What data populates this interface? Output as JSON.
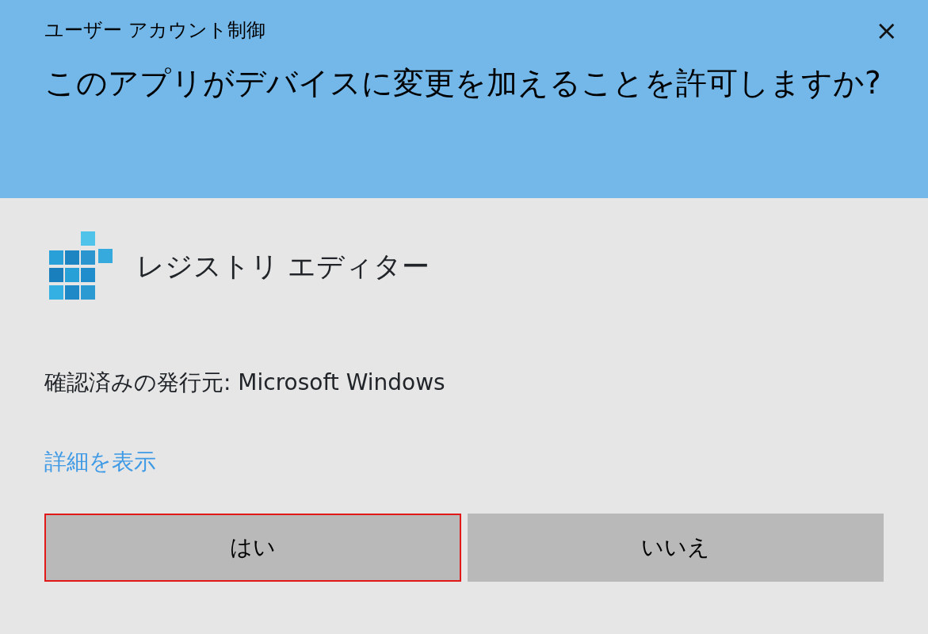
{
  "window": {
    "title": "ユーザー アカウント制御",
    "close": "×"
  },
  "question": "このアプリがデバイスに変更を加えることを許可しますか?",
  "app": {
    "name": "レジストリ エディター"
  },
  "publisher": "確認済みの発行元: Microsoft Windows",
  "details_link": "詳細を表示",
  "buttons": [
    {
      "label": "はい",
      "highlighted": true
    },
    {
      "label": "いいえ",
      "highlighted": false
    }
  ]
}
